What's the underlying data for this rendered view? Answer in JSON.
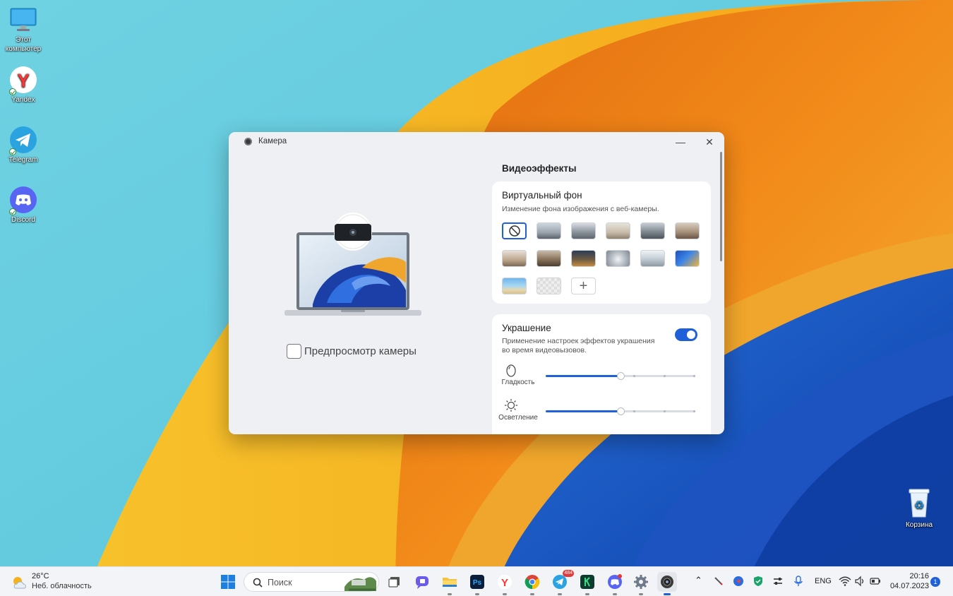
{
  "desktop": {
    "icons": [
      {
        "label": "Этот компьютер",
        "icon": "monitor-icon"
      },
      {
        "label": "Yandex",
        "icon": "yandex-icon"
      },
      {
        "label": "Telegram",
        "icon": "telegram-icon"
      },
      {
        "label": "Discord",
        "icon": "discord-icon"
      }
    ],
    "recycle_bin": {
      "label": "Корзина",
      "icon": "recycle-bin-icon"
    }
  },
  "window": {
    "title": "Камера",
    "minimize_label": "—",
    "close_label": "✕",
    "preview": {
      "checkbox_label": "Предпросмотр камеры",
      "checked": false
    },
    "effects": {
      "title": "Видеоэффекты",
      "virtual_bg": {
        "title": "Виртуальный фон",
        "subtitle": "Изменение фона изображения с веб-камеры.",
        "tiles": [
          "none",
          "office-1",
          "office-2",
          "office-3",
          "office-4",
          "living-room-1",
          "living-room-2",
          "interior-3",
          "city-night",
          "tunnel",
          "mountains",
          "waves",
          "beach",
          "transparent",
          "add"
        ],
        "add_label": "+"
      },
      "beauty": {
        "title": "Украшение",
        "subtitle_line1": "Применение настроек эффектов украшения",
        "subtitle_line2": "во время видеовызовов.",
        "enabled": true,
        "sliders": [
          {
            "label": "Гладкость",
            "icon": "egg-icon",
            "value": 0.5
          },
          {
            "label": "Осветление",
            "icon": "sun-icon",
            "value": 0.5
          }
        ]
      }
    }
  },
  "taskbar": {
    "weather": {
      "temp": "26°C",
      "condition": "Неб. облачность"
    },
    "search_placeholder": "Поиск",
    "apps": [
      {
        "name": "start-button",
        "icon": "windows-icon"
      },
      {
        "name": "task-view-button",
        "icon": "task-view-icon"
      },
      {
        "name": "teams-button",
        "icon": "chat-icon"
      },
      {
        "name": "explorer-button",
        "icon": "folder-icon"
      },
      {
        "name": "photoshop-button",
        "icon": "photoshop-icon",
        "text": "Ps"
      },
      {
        "name": "yandex-button",
        "icon": "yandex-icon"
      },
      {
        "name": "chrome-button",
        "icon": "chrome-icon"
      },
      {
        "name": "telegram-button",
        "icon": "telegram-icon",
        "badge": "484"
      },
      {
        "name": "kaspersky-button",
        "icon": "shield-app-icon"
      },
      {
        "name": "discord-button",
        "icon": "discord-icon"
      },
      {
        "name": "settings-button",
        "icon": "gear-icon"
      },
      {
        "name": "camera-button",
        "icon": "camera-icon"
      }
    ],
    "lang": "ENG",
    "time": "20:16",
    "date": "04.07.2023",
    "notifications": "1",
    "colors": {
      "accent": "#1f5fd8"
    }
  }
}
